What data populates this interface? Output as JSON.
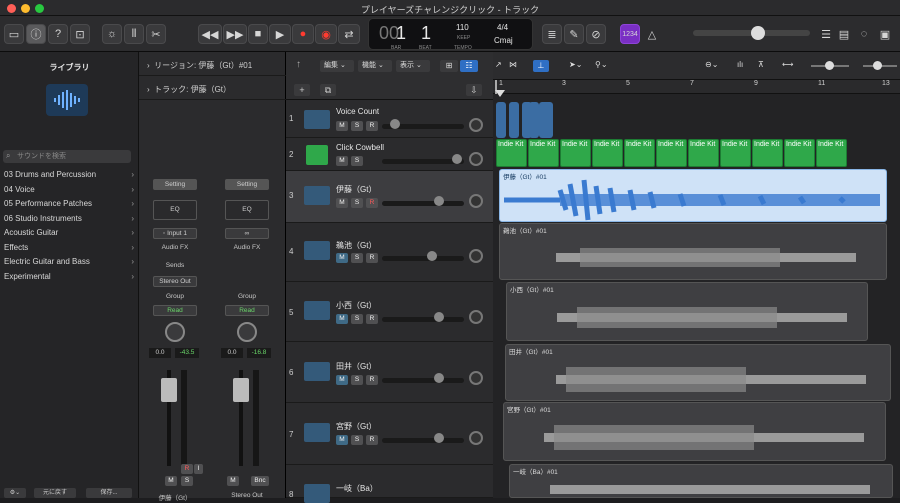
{
  "window": {
    "title": "プレイヤーズチャレンジクリック - トラック"
  },
  "transport": {
    "bar": "1",
    "beat": "1",
    "bar_label": "BAR",
    "beat_label": "BEAT",
    "tempo": "110",
    "keep_label": "KEEP",
    "tempo_label": "TEMPO",
    "signature": "4/4",
    "key": "Cmaj",
    "count_in": "1234"
  },
  "library": {
    "title": "ライブラリ",
    "search_placeholder": "サウンドを検索",
    "items": [
      "03 Drums and Percussion",
      "04 Voice",
      "05 Performance Patches",
      "06 Studio Instruments",
      "Acoustic Guitar",
      "Effects",
      "Electric Guitar and Bass",
      "Experimental"
    ],
    "revert_label": "元に戻す",
    "save_label": "保存..."
  },
  "inspector": {
    "region_row": "リージョン: 伊藤（Gt）#01",
    "track_row": "トラック: 伊藤（Gt）",
    "strip1": {
      "setting": "Setting",
      "eq": "EQ",
      "input": "Input 1",
      "audio_fx": "Audio FX",
      "sends": "Sends",
      "output": "Stereo Out",
      "group": "Group",
      "mode": "Read",
      "pan_val": "0.0",
      "level": "-43.5",
      "name": "伊藤（Gt）"
    },
    "strip2": {
      "setting": "Setting",
      "eq": "EQ",
      "audio_fx": "Audio FX",
      "group": "Group",
      "mode": "Read",
      "pan_val": "0.0",
      "level": "-16.8",
      "bnc": "Bnc",
      "name": "Stereo Out"
    },
    "m_label": "M",
    "s_label": "S",
    "r_label": "R",
    "i_label": "I"
  },
  "arrange_toolbar": {
    "edit": "編集",
    "functions": "機能",
    "view": "表示"
  },
  "ruler": [
    "1",
    "3",
    "5",
    "7",
    "9",
    "11",
    "13"
  ],
  "tracks": [
    {
      "num": "1",
      "name": "Voice Count",
      "buttons": [
        "M",
        "S",
        "R"
      ],
      "selected": false
    },
    {
      "num": "2",
      "name": "Click Cowbell",
      "buttons": [
        "M",
        "S"
      ],
      "selected": false
    },
    {
      "num": "3",
      "name": "伊藤（Gt）",
      "buttons": [
        "M",
        "S",
        "R"
      ],
      "selected": true
    },
    {
      "num": "4",
      "name": "鵜池（Gt）",
      "buttons": [
        "M",
        "S",
        "R"
      ],
      "selected": false
    },
    {
      "num": "5",
      "name": "小西（Gt）",
      "buttons": [
        "M",
        "S",
        "R"
      ],
      "selected": false
    },
    {
      "num": "6",
      "name": "田井（Gt）",
      "buttons": [
        "M",
        "S",
        "R"
      ],
      "selected": false
    },
    {
      "num": "7",
      "name": "宮野（Gt）",
      "buttons": [
        "M",
        "S",
        "R"
      ],
      "selected": false
    },
    {
      "num": "8",
      "name": "一岐（Ba）",
      "buttons": [
        "M",
        "S",
        "R"
      ],
      "selected": false
    }
  ],
  "drum_regions": [
    "Indie Kit",
    "Indie Kit",
    "Indie Kit",
    "Indie Kit",
    "Indie Kit",
    "Indie Kit",
    "Indie Kit",
    "Indie Kit",
    "Indie Kit",
    "Indie Kit",
    "Indie Kit"
  ],
  "regions": [
    {
      "label": "伊藤（Gt）#01",
      "selected": true
    },
    {
      "label": "鵜池（Gt）#01",
      "selected": false
    },
    {
      "label": "小西（Gt）#01",
      "selected": false
    },
    {
      "label": "田井（Gt）#01",
      "selected": false
    },
    {
      "label": "宮野（Gt）#01",
      "selected": false
    },
    {
      "label": "一岐（Ba）#01",
      "selected": false
    }
  ]
}
